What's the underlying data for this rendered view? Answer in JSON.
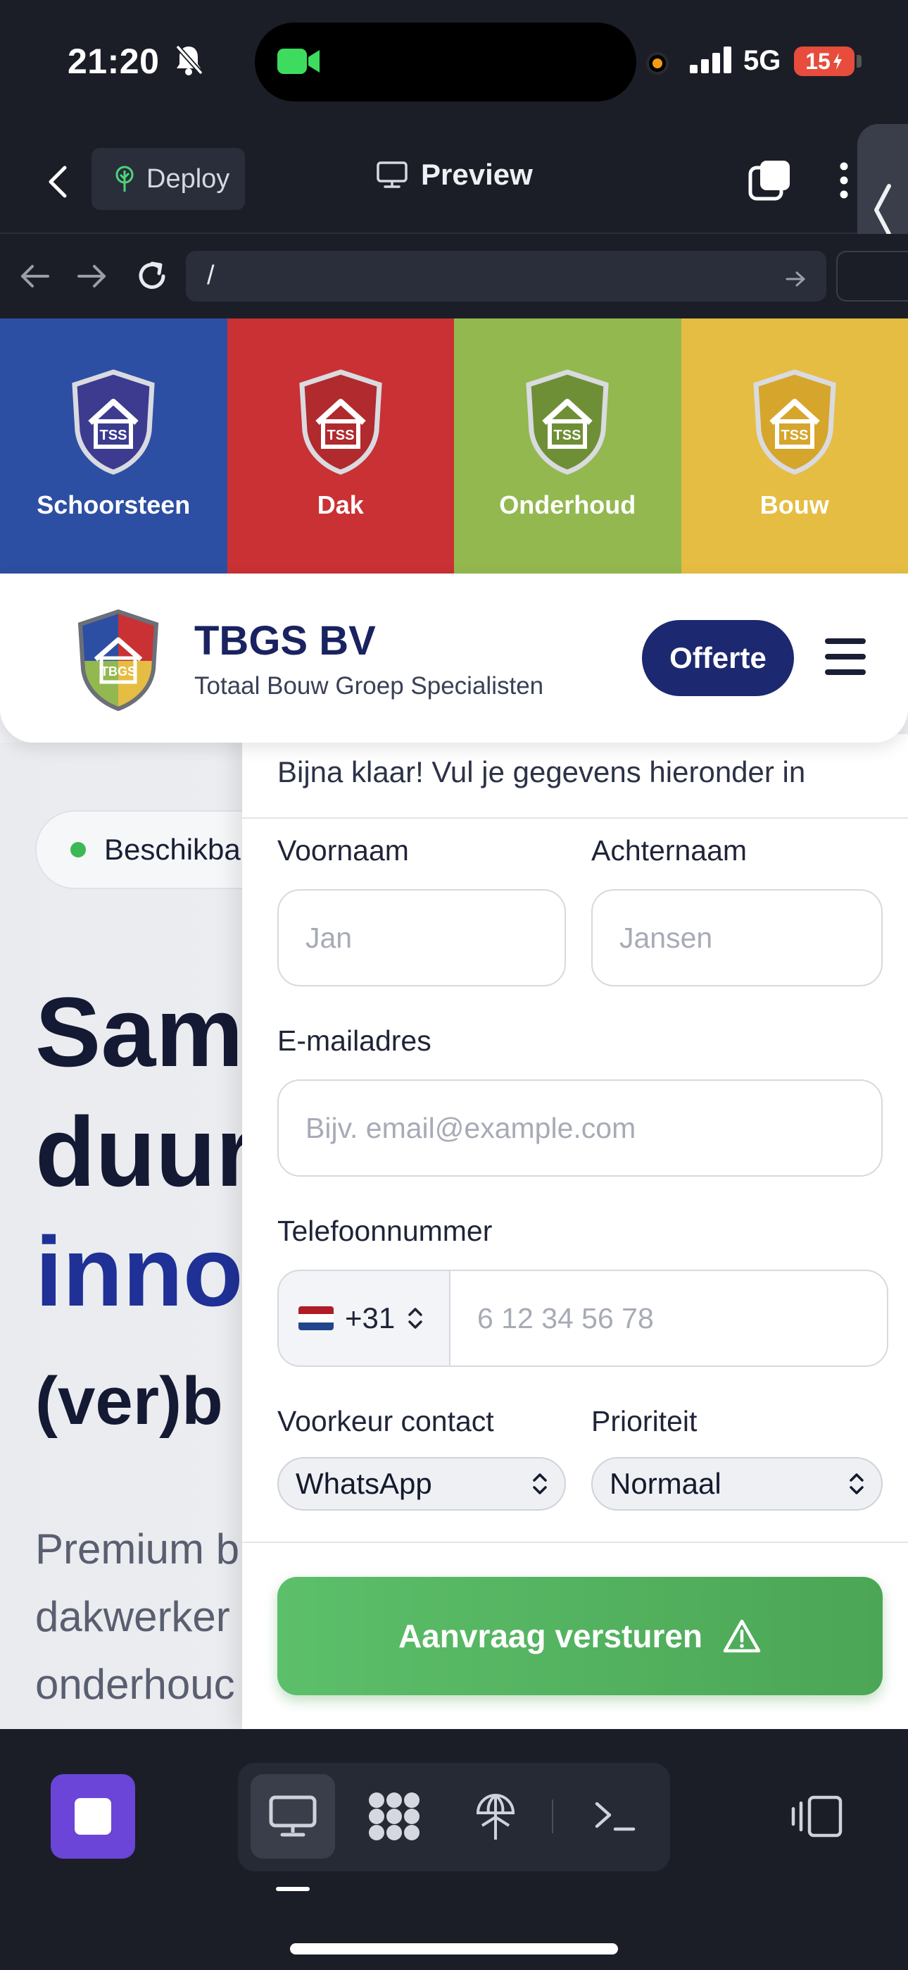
{
  "status_bar": {
    "time": "21:20",
    "network": "5G",
    "battery": "15"
  },
  "toolbar": {
    "deploy_label": "Deploy",
    "preview_label": "Preview"
  },
  "url_bar": {
    "path": "/"
  },
  "categories": [
    {
      "label": "Schoorsteen",
      "color": "#2d4fa3",
      "shield": "#3c3b8f"
    },
    {
      "label": "Dak",
      "color": "#c93134",
      "shield": "#b02a2e"
    },
    {
      "label": "Onderhoud",
      "color": "#93b84f",
      "shield": "#6f8f36"
    },
    {
      "label": "Bouw",
      "color": "#e6bd43",
      "shield": "#d6a52c"
    }
  ],
  "header": {
    "brand": "TBGS BV",
    "tagline": "Totaal Bouw Groep Specialisten",
    "cta": "Offerte"
  },
  "hero": {
    "badge": "Beschikba",
    "line1": "Sam",
    "line2": "duur",
    "line3": "inno",
    "line4": "(ver)b",
    "p1": "Premium b",
    "p2": "dakwerker",
    "p3": "onderhouc"
  },
  "form": {
    "subtitle": "Bijna klaar! Vul je gegevens hieronder in",
    "first_name_label": "Voornaam",
    "first_name_placeholder": "Jan",
    "last_name_label": "Achternaam",
    "last_name_placeholder": "Jansen",
    "email_label": "E-mailadres",
    "email_placeholder": "Bijv. email@example.com",
    "phone_label": "Telefoonnummer",
    "phone_prefix": "+31",
    "phone_placeholder": "6 12 34 56 78",
    "contact_pref_label": "Voorkeur contact",
    "contact_pref_value": "WhatsApp",
    "priority_label": "Prioriteit",
    "priority_value": "Normaal",
    "submit_label": "Aanvraag versturen"
  },
  "colors": {
    "brand_navy": "#1c2870",
    "accent_blue": "#1f3196",
    "submit_green": "#4ba655",
    "dock_accent": "#6a45d8"
  }
}
